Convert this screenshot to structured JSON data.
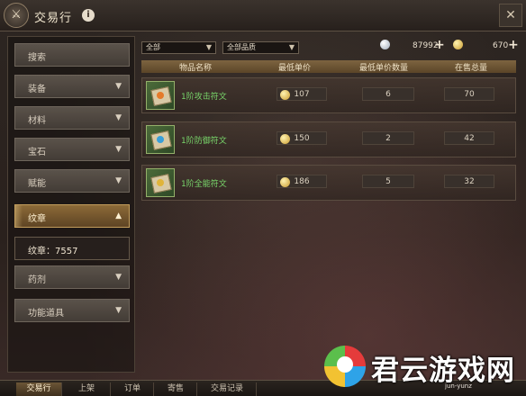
{
  "window": {
    "title": "交易行",
    "emblem_glyph": "⚔",
    "info_glyph": "i",
    "close_glyph": "✕"
  },
  "sidebar": {
    "items": [
      {
        "label": "搜索",
        "chevron": ""
      },
      {
        "label": "装备",
        "chevron": "▼"
      },
      {
        "label": "材料",
        "chevron": "▼"
      },
      {
        "label": "宝石",
        "chevron": "▼"
      },
      {
        "label": "赋能",
        "chevron": "▼"
      },
      {
        "label": "纹章",
        "chevron": "▲",
        "active": true
      },
      {
        "label": "纹章：7557",
        "chevron": ""
      },
      {
        "label": "药剂",
        "chevron": "▼"
      },
      {
        "label": "功能道具",
        "chevron": "▼"
      }
    ]
  },
  "filters": {
    "category": {
      "selected": "全部",
      "arrow": "▼"
    },
    "quality": {
      "selected": "全部品质",
      "arrow": "▼"
    }
  },
  "currency": {
    "silver": {
      "amount": "87992",
      "plus": "+"
    },
    "gold": {
      "amount": "670",
      "plus": "+"
    }
  },
  "table": {
    "headers": [
      "物品名称",
      "最低单价",
      "最低单价数量",
      "在售总量"
    ],
    "rows": [
      {
        "name": "1阶攻击符文",
        "min_price": "107",
        "min_price_qty": "6",
        "total_on_sale": "70",
        "rune_color": "#e57a2a"
      },
      {
        "name": "1阶防御符文",
        "min_price": "150",
        "min_price_qty": "2",
        "total_on_sale": "42",
        "rune_color": "#3a9fd8"
      },
      {
        "name": "1阶全能符文",
        "min_price": "186",
        "min_price_qty": "5",
        "total_on_sale": "32",
        "rune_color": "#e0b43a"
      }
    ]
  },
  "bottom_tabs": [
    {
      "label": "交易行",
      "active": true
    },
    {
      "label": "上架"
    },
    {
      "label": "订单"
    },
    {
      "label": "寄售"
    },
    {
      "label": "交易记录"
    }
  ],
  "watermark": {
    "text": "君云游戏网",
    "sub": "jun-yunz"
  },
  "colors": {
    "accent_gold": "#c39d5c",
    "item_name_green": "#78d56a"
  }
}
